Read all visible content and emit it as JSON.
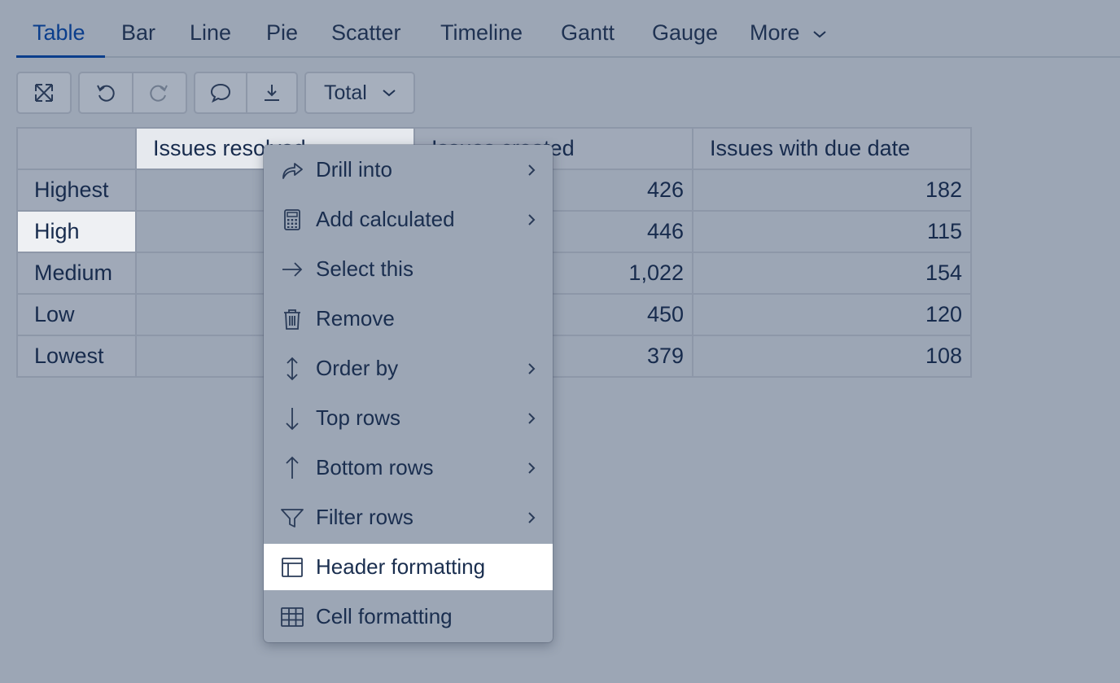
{
  "tabs": [
    {
      "label": "Table",
      "active": true
    },
    {
      "label": "Bar"
    },
    {
      "label": "Line"
    },
    {
      "label": "Pie"
    },
    {
      "label": "Scatter"
    },
    {
      "label": "Timeline"
    },
    {
      "label": "Gantt"
    },
    {
      "label": "Gauge"
    },
    {
      "label": "More"
    }
  ],
  "toolbar": {
    "icons": [
      "fullscreen-icon",
      "undo-icon",
      "redo-icon",
      "comment-icon",
      "download-icon"
    ],
    "total_label": "Total"
  },
  "table": {
    "columns": [
      "Issues resolved",
      "Issues created",
      "Issues with due date"
    ],
    "rows": [
      {
        "label": "Highest",
        "created": "426",
        "due": "182"
      },
      {
        "label": "High",
        "created": "446",
        "due": "115",
        "selected": true
      },
      {
        "label": "Medium",
        "created": "1,022",
        "due": "154"
      },
      {
        "label": "Low",
        "created": "450",
        "due": "120"
      },
      {
        "label": "Lowest",
        "created": "379",
        "due": "108"
      }
    ]
  },
  "context_menu": {
    "items": [
      {
        "label": "Drill into",
        "icon": "share-arrow-icon",
        "submenu": true
      },
      {
        "label": "Add calculated",
        "icon": "calculator-icon",
        "submenu": true
      },
      {
        "label": "Select this",
        "icon": "arrow-right-icon",
        "submenu": false
      },
      {
        "label": "Remove",
        "icon": "trash-icon",
        "submenu": false
      },
      {
        "label": "Order by",
        "icon": "sort-vertical-icon",
        "submenu": true
      },
      {
        "label": "Top rows",
        "icon": "arrow-down-icon",
        "submenu": true
      },
      {
        "label": "Bottom rows",
        "icon": "arrow-up-icon",
        "submenu": true
      },
      {
        "label": "Filter rows",
        "icon": "filter-icon",
        "submenu": true
      },
      {
        "label": "Header formatting",
        "icon": "header-format-icon",
        "submenu": false,
        "highlighted": true
      },
      {
        "label": "Cell formatting",
        "icon": "cell-format-icon",
        "submenu": false
      }
    ]
  },
  "colors": {
    "accent": "#0b3e8c",
    "text": "#172b4d",
    "overlay_bg": "#9ca6b5",
    "highlight": "#ffffff"
  }
}
